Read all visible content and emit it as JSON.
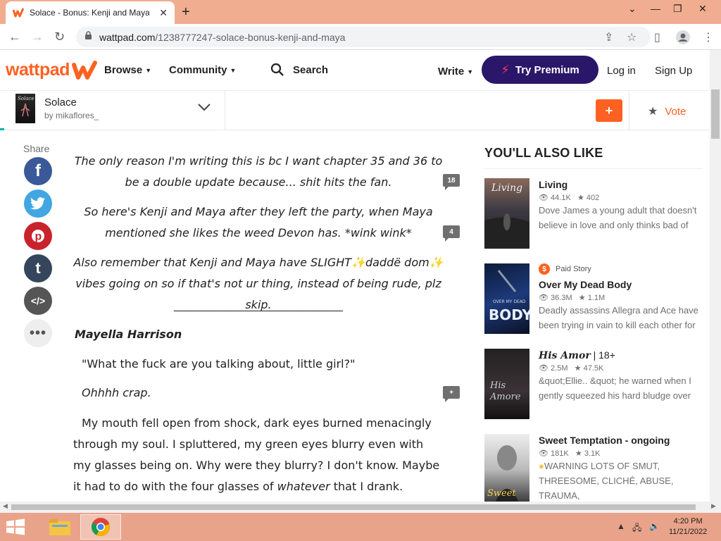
{
  "browser": {
    "tab_title": "Solace - Bonus: Kenji and Maya - ",
    "url_host": "wattpad.com",
    "url_path": "/1238777247-solace-bonus-kenji-and-maya"
  },
  "header": {
    "logo": "wattpad",
    "browse": "Browse",
    "community": "Community",
    "search": "Search",
    "write": "Write",
    "premium": "Try Premium",
    "login": "Log in",
    "signup": "Sign Up"
  },
  "story": {
    "title": "Solace",
    "author": "by mikaflores_",
    "add": "+",
    "vote": "Vote"
  },
  "share": {
    "label": "Share"
  },
  "content": {
    "p1": "The only reason I'm writing this is bc I want chapter 35 and 36 to be a double update because... shit hits the fan.",
    "p1_comments": "18",
    "p2": "So here's Kenji and Maya after they left the party, when Maya mentioned she likes the weed Devon has. *wink wink*",
    "p2_comments": "4",
    "p3_a": "Also remember that Kenji and Maya have SLIGHT",
    "p3_b": "daddë dom",
    "p3_c": "vibes going on so if that's not ur thing, instead of being rude, plz skip.",
    "divider": "______________________________",
    "heading": "Mayella Harrison",
    "quote": "\"What the fuck are you talking about, little girl?\"",
    "ohhh": "Ohhhh crap.",
    "ohhh_comments": "+",
    "body_a": "My mouth fell open from shock, dark eyes burned menacingly through my soul. I spluttered, my green eyes blurry even with my glasses being on. Why were they blurry? I don't know. Maybe it had to do with the four glasses of ",
    "body_italic": "whatever",
    "body_b": " that I drank. Honestly I couldn't"
  },
  "recommendations": {
    "heading": "YOU'LL ALSO LIKE",
    "items": [
      {
        "title": "Living",
        "reads": "44.1K",
        "votes": "402",
        "desc": "Dove James a young adult that doesn't believe in love and only thinks bad of",
        "paid": ""
      },
      {
        "title": "Over My Dead Body",
        "reads": "36.3M",
        "votes": "1.1M",
        "desc": "Deadly assassins Allegra and Ace have been trying in vain to kill each other for",
        "paid": "Paid Story"
      },
      {
        "title_fancy": "His Amor",
        "title_suffix": " | 18+",
        "reads": "2.5M",
        "votes": "47.5K",
        "desc": "&quot;Ellie.. &quot; he warned when I gently squeezed his hard bludge over",
        "paid": ""
      },
      {
        "title": "Sweet Temptation - ongoing",
        "reads": "181K",
        "votes": "3.1K",
        "desc": "WARNING LOTS OF SMUT, THREESOME, CLICHÉ, ABUSE, TRAUMA,",
        "paid": ""
      }
    ]
  },
  "taskbar": {
    "time": "4:20 PM",
    "date": "11/21/2022"
  },
  "colors": {
    "brand": "#ff6122",
    "premium": "#2a1769",
    "chrome_frame": "#f0ad8f"
  }
}
